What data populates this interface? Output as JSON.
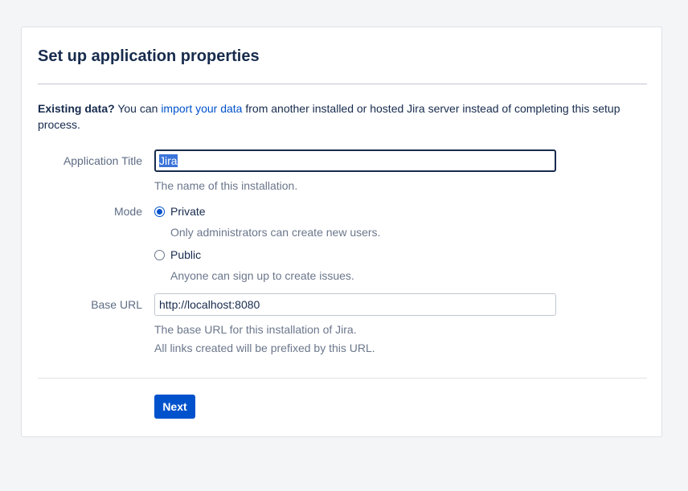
{
  "page": {
    "title": "Set up application properties"
  },
  "intro": {
    "bold_text": "Existing data?",
    "text_before_link": " You can ",
    "link_text": "import your data",
    "text_after_link": " from another installed or hosted Jira server instead of completing this setup process."
  },
  "form": {
    "app_title": {
      "label": "Application Title",
      "value": "Jira",
      "help": "The name of this installation."
    },
    "mode": {
      "label": "Mode",
      "selected": "Private",
      "options": [
        {
          "label": "Private",
          "help": "Only administrators can create new users.",
          "checked": true
        },
        {
          "label": "Public",
          "help": "Anyone can sign up to create issues.",
          "checked": false
        }
      ]
    },
    "base_url": {
      "label": "Base URL",
      "value": "http://localhost:8080",
      "help_line1": "The base URL for this installation of Jira.",
      "help_line2": "All links created will be prefixed by this URL."
    }
  },
  "actions": {
    "next_label": "Next"
  },
  "colors": {
    "accent": "#0052cc",
    "page_background": "#f4f5f7",
    "text": "#172b4d",
    "subtle_text": "#6b778c"
  }
}
